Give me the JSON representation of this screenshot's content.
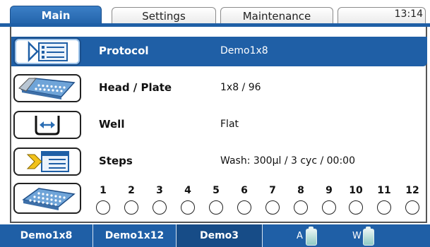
{
  "tabs": [
    {
      "label": "Main",
      "active": true
    },
    {
      "label": "Settings",
      "active": false
    },
    {
      "label": "Maintenance",
      "active": false
    }
  ],
  "clock": "13:14",
  "rows": [
    {
      "icon": "protocol-list-icon",
      "label": "Protocol",
      "value": "Demo1x8",
      "selected": true
    },
    {
      "icon": "head-plate-icon",
      "label": "Head / Plate",
      "value": "1x8 / 96",
      "selected": false
    },
    {
      "icon": "well-shape-icon",
      "label": "Well",
      "value": "Flat",
      "selected": false
    },
    {
      "icon": "steps-list-icon",
      "label": "Steps",
      "value": "Wash: 300µl / 3 cyc / 00:00",
      "selected": false
    }
  ],
  "wells": {
    "icon": "plate-icon",
    "columns": [
      "1",
      "2",
      "3",
      "4",
      "5",
      "6",
      "7",
      "8",
      "9",
      "10",
      "11",
      "12"
    ]
  },
  "bottom": {
    "buttons": [
      "Demo1x8",
      "Demo1x12",
      "Demo3"
    ],
    "pressed_index": 2,
    "bottles": [
      {
        "label": "A",
        "icon": "bottle-a-icon"
      },
      {
        "label": "W",
        "icon": "bottle-w-icon"
      }
    ]
  },
  "colors": {
    "accent": "#1f5fa6",
    "bottle": "#8fcac4"
  }
}
